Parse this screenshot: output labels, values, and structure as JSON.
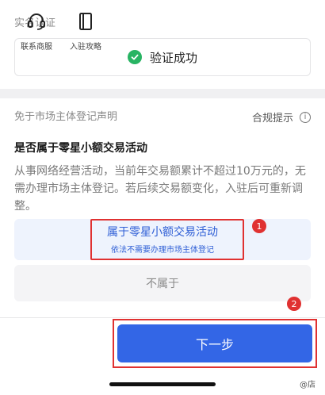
{
  "realname": {
    "section_title": "实名认证",
    "status_text": "验证成功",
    "status_color": "#28b463"
  },
  "declaration": {
    "section_title": "免于市场主体登记声明",
    "compliance_label": "合规提示",
    "question": "是否属于零星小额交易活动",
    "description": "从事网络经营活动，当前年交易额累计不超过10万元的，无需办理市场主体登记。若后续交易额变化，入驻后可重新调整。",
    "option_yes": {
      "label": "属于零星小额交易活动",
      "sublabel": "依法不需要办理市场主体登记"
    },
    "option_no": {
      "label": "不属于"
    },
    "selected_option": "option_yes"
  },
  "annotations": {
    "badge_1": "1",
    "badge_2": "2",
    "highlight_color": "#e03131"
  },
  "footer": {
    "service_label": "联系商服",
    "guide_label": "入驻攻略",
    "next_label": "下一步",
    "next_color": "#3366e6",
    "watermark": "@店"
  },
  "icons": {
    "check": "check-circle-icon",
    "info": "info-icon",
    "headset": "headset-icon",
    "guide": "book-icon"
  }
}
